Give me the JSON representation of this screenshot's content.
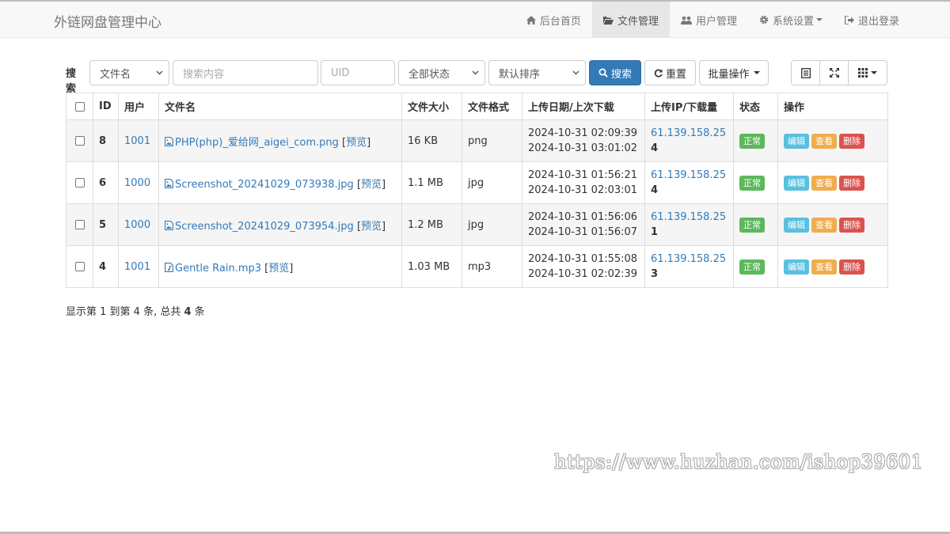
{
  "header": {
    "brand": "外链网盘管理中心",
    "nav": [
      {
        "label": "后台首页",
        "icon": "home-icon"
      },
      {
        "label": "文件管理",
        "icon": "folder-open-icon",
        "active": true
      },
      {
        "label": "用户管理",
        "icon": "users-icon"
      },
      {
        "label": "系统设置",
        "icon": "gear-icon",
        "dropdown": true
      },
      {
        "label": "退出登录",
        "icon": "logout-icon"
      }
    ]
  },
  "search": {
    "label": "搜索",
    "field_select": "文件名",
    "keyword_placeholder": "搜索内容",
    "uid_placeholder": "UID",
    "status_select": "全部状态",
    "sort_select": "默认排序",
    "search_button": "搜索",
    "reset_button": "重置",
    "batch_button": "批量操作"
  },
  "table": {
    "headers": [
      "ID",
      "用户",
      "文件名",
      "文件大小",
      "文件格式",
      "上传日期/上次下载",
      "上传IP/下载量",
      "状态",
      "操作"
    ],
    "preview_label": "预览",
    "action_labels": {
      "edit": "编辑",
      "view": "查看",
      "delete": "删除"
    },
    "rows": [
      {
        "id": "8",
        "user": "1001",
        "filename": "PHP(php)_爱给网_aigei_com.png",
        "file_type": "image",
        "size": "16 KB",
        "format": "png",
        "upload_date": "2024-10-31 02:09:39",
        "last_download": "2024-10-31 03:01:02",
        "ip": "61.139.158.25",
        "downloads": "4",
        "status": "正常"
      },
      {
        "id": "6",
        "user": "1000",
        "filename": "Screenshot_20241029_073938.jpg",
        "file_type": "image",
        "size": "1.1 MB",
        "format": "jpg",
        "upload_date": "2024-10-31 01:56:21",
        "last_download": "2024-10-31 02:03:01",
        "ip": "61.139.158.25",
        "downloads": "4",
        "status": "正常"
      },
      {
        "id": "5",
        "user": "1000",
        "filename": "Screenshot_20241029_073954.jpg",
        "file_type": "image",
        "size": "1.2 MB",
        "format": "jpg",
        "upload_date": "2024-10-31 01:56:06",
        "last_download": "2024-10-31 01:56:07",
        "ip": "61.139.158.25",
        "downloads": "1",
        "status": "正常"
      },
      {
        "id": "4",
        "user": "1001",
        "filename": "Gentle Rain.mp3",
        "file_type": "audio",
        "size": "1.03 MB",
        "format": "mp3",
        "upload_date": "2024-10-31 01:55:08",
        "last_download": "2024-10-31 02:02:39",
        "ip": "61.139.158.25",
        "downloads": "3",
        "status": "正常"
      }
    ]
  },
  "pagination": {
    "prefix": "显示第 1 到第 4 条, 总共 ",
    "total": "4",
    "suffix": " 条"
  },
  "watermark": "https://www.huzhan.com/ishop39601",
  "colors": {
    "primary": "#337ab7",
    "success": "#5cb85c",
    "info": "#5bc0de",
    "warning": "#f0ad4e",
    "danger": "#d9534f"
  }
}
